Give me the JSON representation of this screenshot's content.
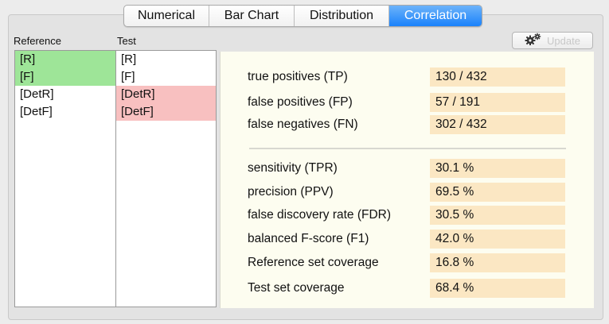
{
  "tabs": [
    {
      "label": "Numerical",
      "active": false
    },
    {
      "label": "Bar Chart",
      "active": false
    },
    {
      "label": "Distribution",
      "active": false
    },
    {
      "label": "Correlation",
      "active": true
    }
  ],
  "reference": {
    "header": "Reference",
    "items": [
      {
        "label": "[R]",
        "highlight": "green"
      },
      {
        "label": "[F]",
        "highlight": "green"
      },
      {
        "label": "[DetR]",
        "highlight": "none"
      },
      {
        "label": "[DetF]",
        "highlight": "none"
      }
    ]
  },
  "test": {
    "header": "Test",
    "items": [
      {
        "label": "[R]",
        "highlight": "none"
      },
      {
        "label": "[F]",
        "highlight": "none"
      },
      {
        "label": "[DetR]",
        "highlight": "red"
      },
      {
        "label": "[DetF]",
        "highlight": "red"
      }
    ]
  },
  "update_button": {
    "label": "Update",
    "icon": "gears-icon",
    "enabled": false
  },
  "counts": [
    {
      "label": "true positives (TP)",
      "value": "130 / 432"
    },
    {
      "label": "false positives (FP)",
      "value": "57 / 191"
    },
    {
      "label": "false negatives (FN)",
      "value": "302 / 432"
    }
  ],
  "metrics": [
    {
      "label": "sensitivity (TPR)",
      "value": "30.1 %"
    },
    {
      "label": "precision (PPV)",
      "value": "69.5 %"
    },
    {
      "label": "false discovery rate (FDR)",
      "value": "30.5 %"
    },
    {
      "label": "balanced F-score (F1)",
      "value": "42.0 %"
    },
    {
      "label": "Reference set coverage",
      "value": "16.8 %"
    },
    {
      "label": "Test set coverage",
      "value": "68.4 %"
    }
  ],
  "colors": {
    "tab_active": "#1a82fb",
    "match_green": "#9ee598",
    "mismatch_red": "#f8c0c0",
    "value_bg": "#fbe7c3",
    "panel_bg": "#fdfdf0"
  }
}
